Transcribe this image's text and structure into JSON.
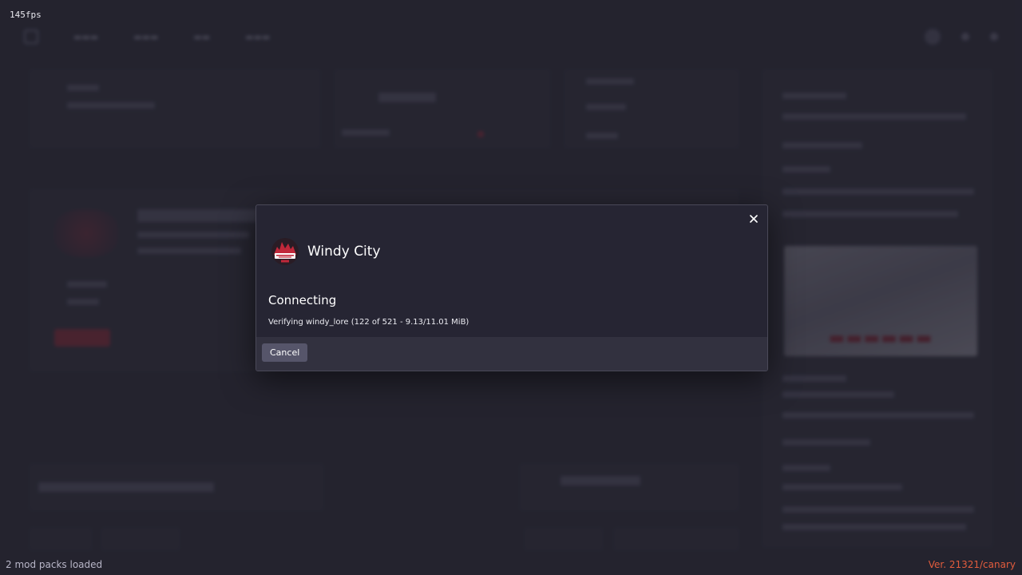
{
  "overlay": {
    "fps": "145fps",
    "mod_packs": "2 mod packs loaded",
    "version": "Ver. 21321/canary"
  },
  "modal": {
    "server_name": "Windy City",
    "logo_icon": "windy-city-server-logo",
    "status_title": "Connecting",
    "status_detail": "Verifying windy_lore (122 of 521 - 9.13/11.01 MiB)",
    "cancel_label": "Cancel",
    "close_icon": "close-icon"
  },
  "colors": {
    "modal_bg": "#262533",
    "footer_bg": "#32313f",
    "button_bg": "#56556a",
    "version_accent": "#e25c3d"
  }
}
